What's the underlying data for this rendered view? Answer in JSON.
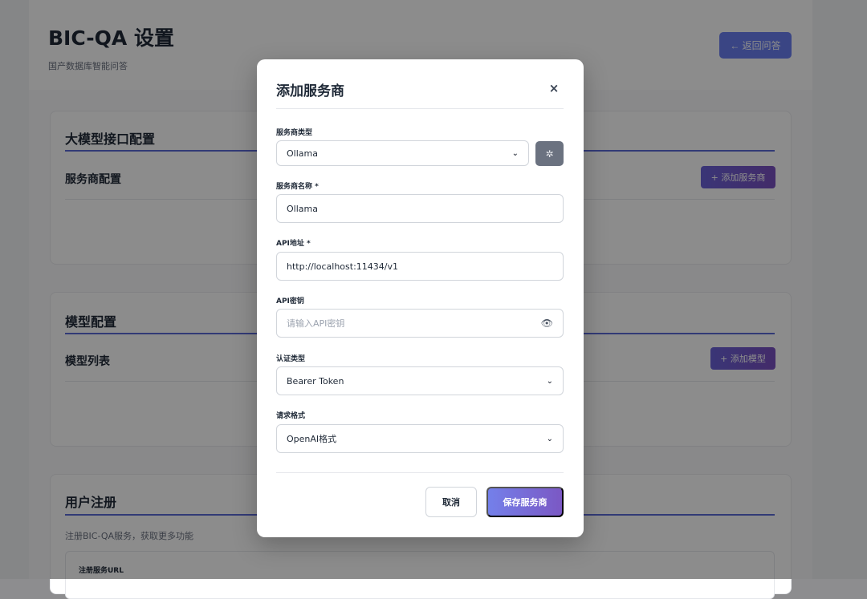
{
  "page": {
    "title": "BIC-QA 设置",
    "subtitle": "国产数据库智能问答",
    "back_button": "← 返回问答"
  },
  "llm_card": {
    "title": "大模型接口配置",
    "section": "服务商配置",
    "add_button": "+ 添加服务商"
  },
  "model_card": {
    "title": "模型配置",
    "section": "模型列表",
    "add_button": "+ 添加模型"
  },
  "register_card": {
    "title": "用户注册",
    "description": "注册BIC-QA服务，获取更多功能",
    "url_label": "注册服务URL"
  },
  "modal": {
    "title": "添加服务商",
    "close": "×",
    "provider_type": {
      "label": "服务商类型",
      "value": "Ollama"
    },
    "provider_name": {
      "label": "服务商名称 *",
      "value": "Ollama"
    },
    "api_url": {
      "label": "API地址 *",
      "value": "http://localhost:11434/v1"
    },
    "api_key": {
      "label": "API密钥",
      "placeholder": "请输入API密钥"
    },
    "auth_type": {
      "label": "认证类型",
      "value": "Bearer Token"
    },
    "request_format": {
      "label": "请求格式",
      "value": "OpenAI格式"
    },
    "cancel": "取消",
    "save": "保存服务商"
  },
  "colors": {
    "accent": "#6b7ff0",
    "accent_dark": "#5b6bd8",
    "overlay": "rgba(0,0,0,0.45)"
  },
  "icons": {
    "gear_button": "gear-icon",
    "api_key_toggle": "eye-icon",
    "select_arrow": "chevron-down-icon"
  }
}
